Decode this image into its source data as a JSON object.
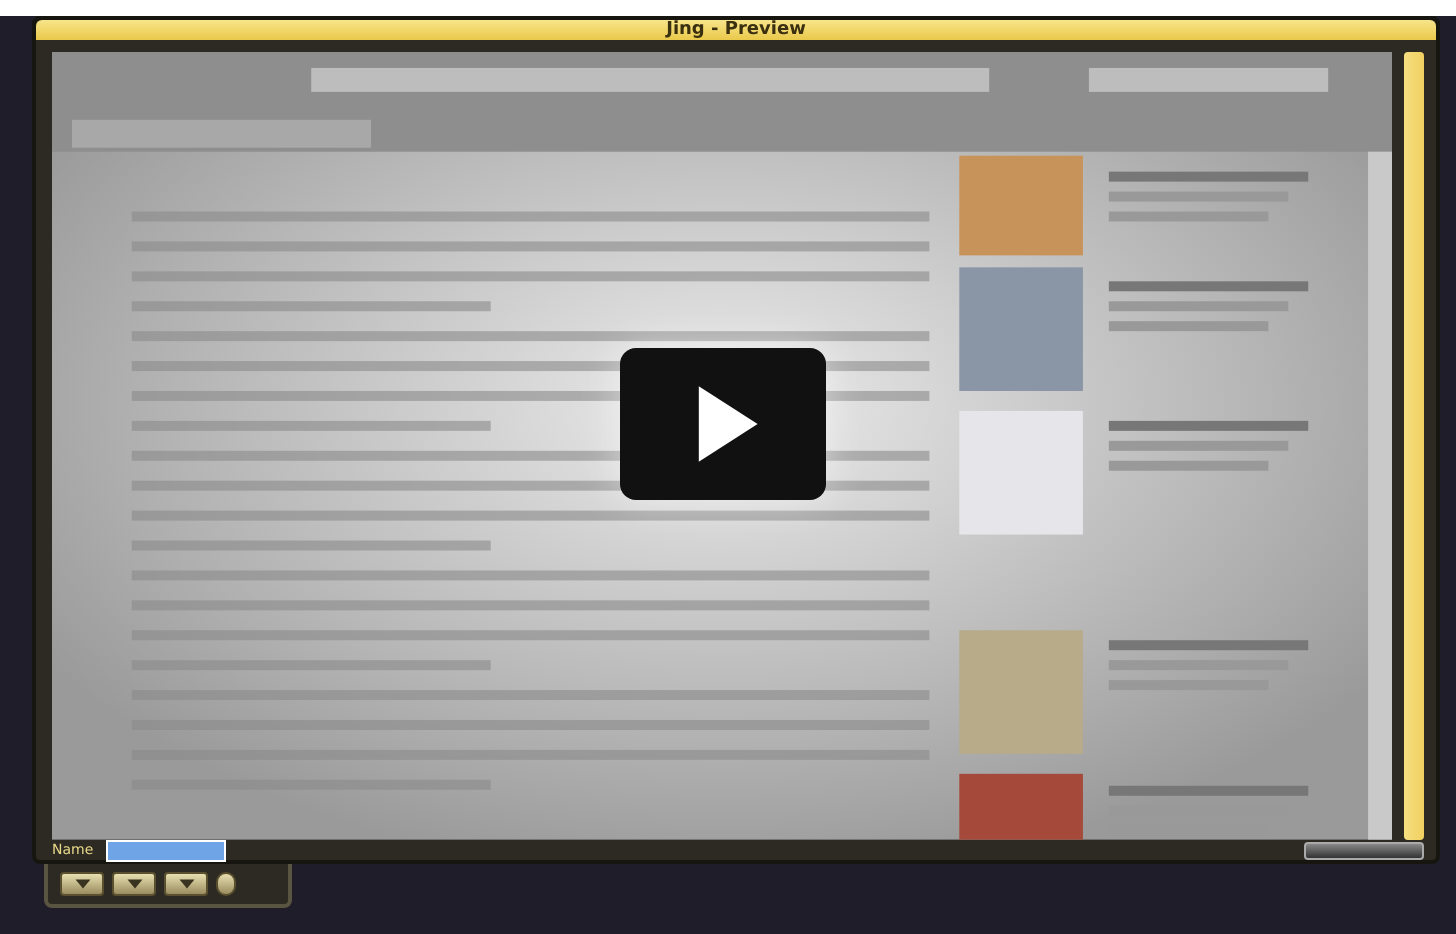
{
  "window": {
    "title": "Jing - Preview"
  },
  "player": {
    "playing": false
  },
  "name_field": {
    "label": "Name"
  }
}
